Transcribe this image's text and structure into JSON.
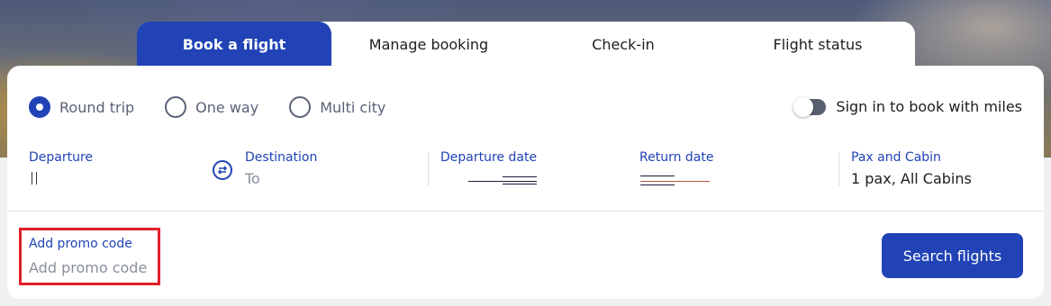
{
  "tabs": [
    {
      "label": "Book a flight"
    },
    {
      "label": "Manage booking"
    },
    {
      "label": "Check-in"
    },
    {
      "label": "Flight status"
    }
  ],
  "trip_types": [
    {
      "label": "Round trip",
      "selected": true
    },
    {
      "label": "One way",
      "selected": false
    },
    {
      "label": "Multi city",
      "selected": false
    }
  ],
  "miles_toggle": {
    "label": "Sign in to book with miles",
    "on": false
  },
  "fields": {
    "departure": {
      "label": "Departure",
      "value": ""
    },
    "destination": {
      "label": "Destination",
      "placeholder": "To"
    },
    "departure_date": {
      "label": "Departure date"
    },
    "return_date": {
      "label": "Return date"
    },
    "pax_cabin": {
      "label": "Pax and Cabin",
      "value": "1 pax, All Cabins"
    }
  },
  "promo": {
    "label": "Add promo code",
    "placeholder": "Add promo code"
  },
  "search_button": {
    "label": "Search flights"
  },
  "colors": {
    "accent": "#2143b5",
    "highlight": "#e0202a",
    "muted_text": "#5a6178"
  },
  "icons": [
    "swap-arrows-icon",
    "radio-checked-icon",
    "radio-unchecked-icon",
    "toggle-switch-icon"
  ]
}
